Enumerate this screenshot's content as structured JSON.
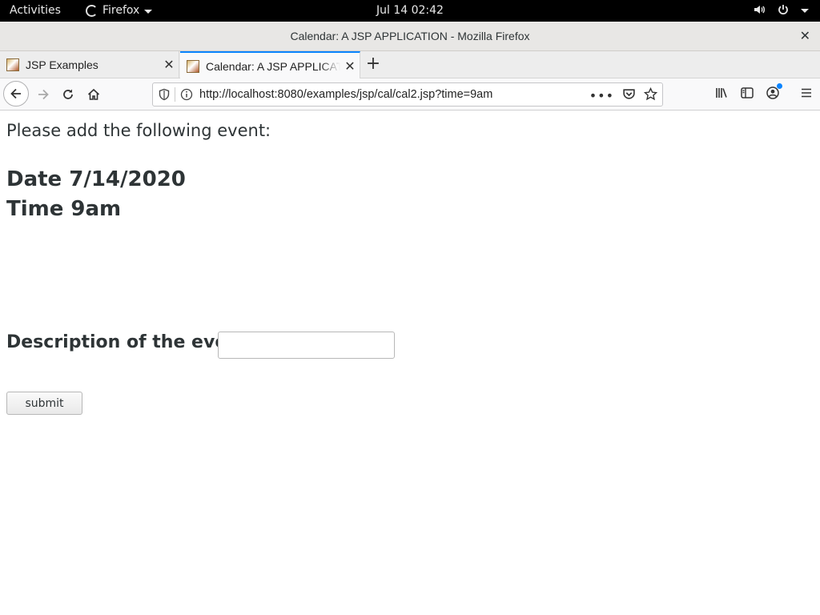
{
  "topbar": {
    "activities": "Activities",
    "app_menu": "Firefox",
    "clock": "Jul 14  02:42"
  },
  "window": {
    "title": "Calendar: A JSP APPLICATION - Mozilla Firefox"
  },
  "tabs": [
    {
      "label": "JSP Examples",
      "active": false
    },
    {
      "label": "Calendar: A JSP APPLICATION",
      "active": true
    }
  ],
  "navbar": {
    "url": "http://localhost:8080/examples/jsp/cal/cal2.jsp?time=9am"
  },
  "page": {
    "intro": "Please add the following event:",
    "date": "Date 7/14/2020",
    "time": "Time 9am",
    "description_label": "Description of the event",
    "description_value": "",
    "submit_label": "submit"
  },
  "colors": {
    "accent": "#0a84ff",
    "text": "#2e3436",
    "topbar": "#000000"
  },
  "icons": [
    "firefox-icon",
    "volume-icon",
    "power-icon",
    "back-arrow-icon",
    "forward-arrow-icon",
    "reload-icon",
    "home-icon",
    "tracking-shield-icon",
    "site-info-icon",
    "page-actions-icon",
    "pocket-icon",
    "bookmark-star-icon",
    "library-icon",
    "sidebar-icon",
    "account-icon",
    "hamburger-menu-icon",
    "close-icon",
    "new-tab-icon"
  ]
}
